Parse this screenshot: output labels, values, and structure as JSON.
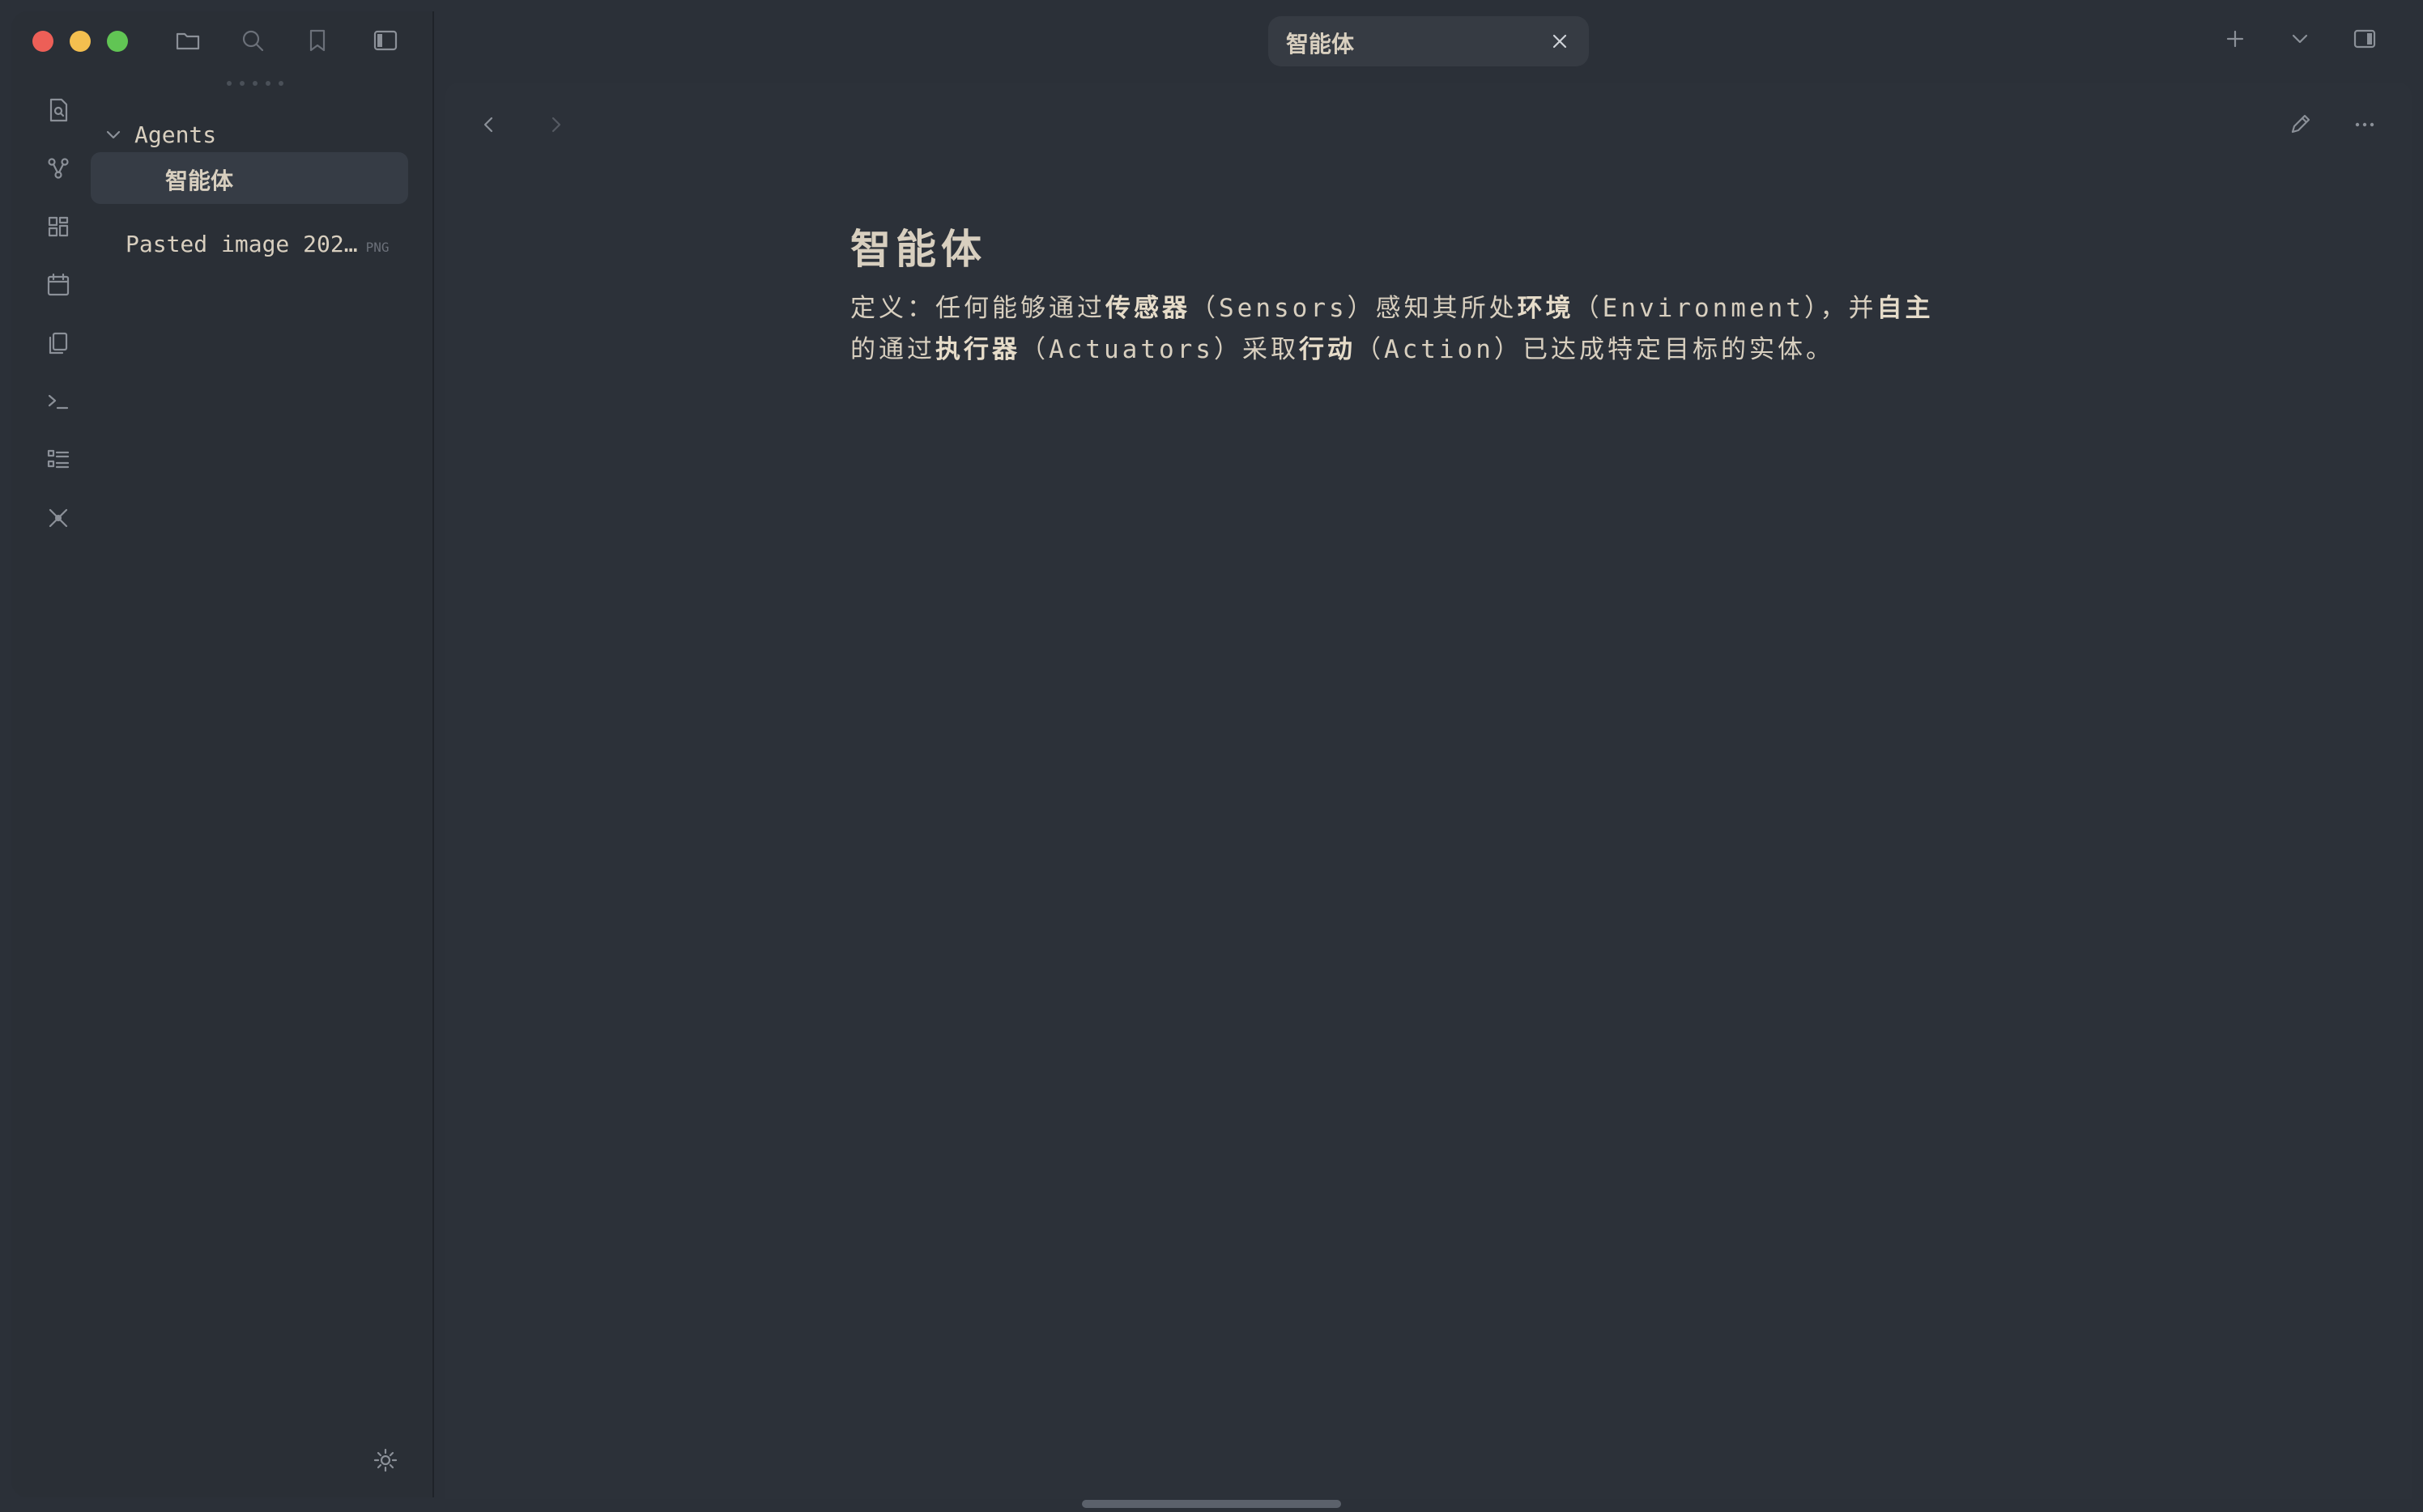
{
  "window": {
    "controls": {
      "close": "close",
      "minimize": "minimize",
      "zoom": "zoom"
    }
  },
  "sidebar_toolbar": {
    "icons": [
      "folder-icon",
      "search-icon",
      "bookmark-icon",
      "sidebar-toggle-icon"
    ]
  },
  "ribbon": {
    "icons": [
      "quick-switcher-icon",
      "graph-view-icon",
      "canvas-icon",
      "daily-note-icon",
      "templates-icon",
      "command-palette-icon",
      "outline-icon",
      "plugin-icon"
    ]
  },
  "file_tree": {
    "folder": {
      "label": "Agents",
      "expanded": true
    },
    "items": [
      {
        "label": "智能体",
        "active": true
      },
      {
        "label": "Pasted image 202…",
        "ext": "PNG"
      }
    ]
  },
  "tab": {
    "title": "智能体"
  },
  "top_right": {
    "icons": [
      "new-tab-icon",
      "tab-list-icon",
      "right-sidebar-icon"
    ]
  },
  "editor": {
    "title": "智能体",
    "line1": {
      "a": "定义：任何能够通过",
      "b": "传感器",
      "c": "（Sensors）感知其所处",
      "d": "环境",
      "e": "（Environment），并",
      "f": "自主"
    },
    "line2": {
      "a": "的通过",
      "b": "执行器",
      "c": "（Actuators）采取",
      "d": "行动",
      "e": "（Action）已达成特定目标的实体。"
    }
  },
  "colors": {
    "background": "#2b3038",
    "text": "#d8cfbf",
    "active_item": "#363c45",
    "traffic_red": "#ed5f57",
    "traffic_yellow": "#f4bf4f",
    "traffic_green": "#61c554"
  }
}
